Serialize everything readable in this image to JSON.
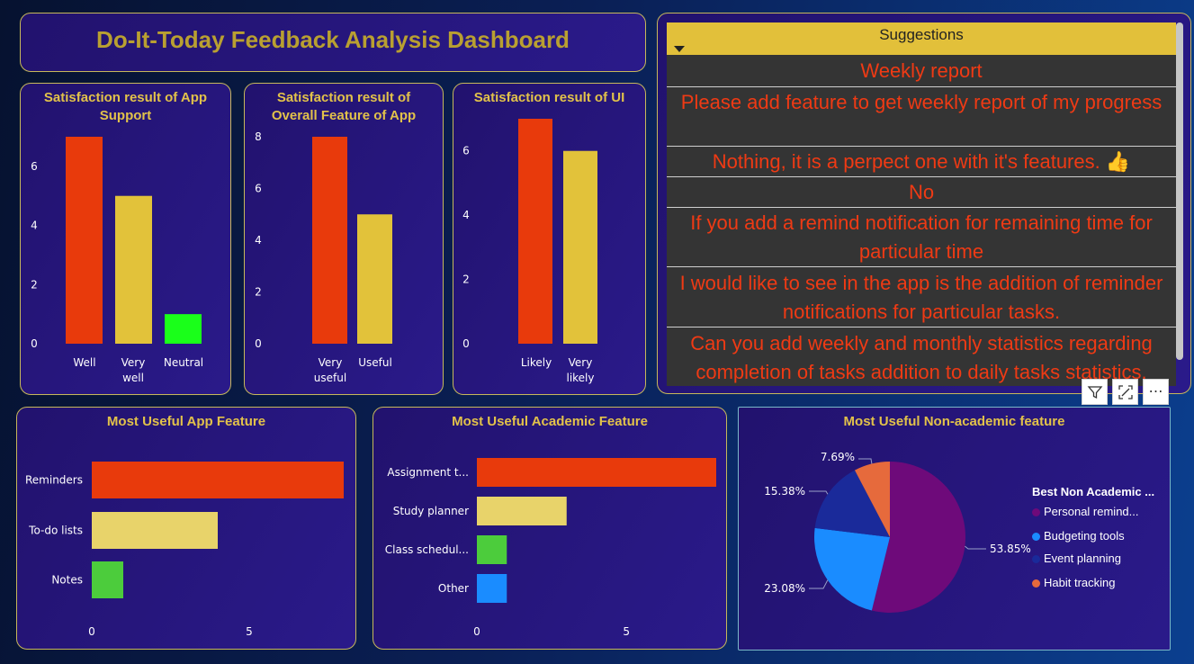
{
  "dashboard_title": "Do-It-Today Feedback Analysis Dashboard",
  "colors": {
    "orange_red": "#e83a0c",
    "gold": "#e2c23a",
    "light_gold": "#e8d36a",
    "green": "#4ccc3c",
    "neon_green": "#1aff1a",
    "blue": "#1a8cff",
    "purple": "#6e0a7a",
    "navy": "#1a2a9a",
    "coral": "#e66a3c",
    "title_gold": "#e2c24a",
    "suggestion_text": "#ef3a14"
  },
  "suggestions": {
    "header": "Suggestions",
    "rows": [
      "Weekly report",
      "Please add feature to get weekly report of my progress",
      "Nothing, it is a perpect one with it's features. 👍",
      "No",
      "If you add a remind notification for remaining time for particular time",
      "I would like to see in the app is the addition of reminder notifications for particular tasks.",
      "Can you add weekly and monthly statistics regarding completion of tasks addition to daily tasks statistics."
    ]
  },
  "toolbar": {
    "filter_icon": "filter-icon",
    "focus_icon": "focus-mode-icon",
    "more_icon": "more-options-icon",
    "more_label": "⋯"
  },
  "chart_data": [
    {
      "id": "app_support",
      "type": "bar",
      "title": "Satisfaction result of App Support",
      "categories": [
        "Well",
        "Very well",
        "Neutral"
      ],
      "values": [
        7,
        5,
        1
      ],
      "ylim": [
        0,
        7
      ],
      "yticks": [
        0,
        2,
        4,
        6
      ],
      "colors": [
        "#e83a0c",
        "#e2c23a",
        "#1aff1a"
      ]
    },
    {
      "id": "overall_feature",
      "type": "bar",
      "title": "Satisfaction result of Overall Feature of App",
      "categories": [
        "Very useful",
        "Useful"
      ],
      "values": [
        8,
        5
      ],
      "ylim": [
        0,
        8
      ],
      "yticks": [
        0,
        2,
        4,
        6,
        8
      ],
      "colors": [
        "#e83a0c",
        "#e2c23a"
      ]
    },
    {
      "id": "ui",
      "type": "bar",
      "title": "Satisfaction result of UI",
      "categories": [
        "Likely",
        "Very likely"
      ],
      "values": [
        7,
        6
      ],
      "ylim": [
        0,
        7
      ],
      "yticks": [
        0,
        2,
        4,
        6
      ],
      "colors": [
        "#e83a0c",
        "#e2c23a"
      ]
    },
    {
      "id": "app_feature",
      "type": "bar",
      "orientation": "horizontal",
      "title": "Most Useful App Feature",
      "categories": [
        "Reminders",
        "To-do lists",
        "Notes"
      ],
      "values": [
        8,
        4,
        1
      ],
      "xlim": [
        0,
        8
      ],
      "xticks": [
        0,
        5
      ],
      "colors": [
        "#e83a0c",
        "#e8d36a",
        "#4ccc3c"
      ]
    },
    {
      "id": "academic_feature",
      "type": "bar",
      "orientation": "horizontal",
      "title": "Most Useful Academic Feature",
      "categories": [
        "Assignment t...",
        "Study planner",
        "Class schedul...",
        "Other"
      ],
      "values": [
        8,
        3,
        1,
        1
      ],
      "xlim": [
        0,
        8
      ],
      "xticks": [
        0,
        5
      ],
      "colors": [
        "#e83a0c",
        "#e8d36a",
        "#4ccc3c",
        "#1a8cff"
      ]
    },
    {
      "id": "non_academic",
      "type": "pie",
      "title": "Most Useful Non-academic feature",
      "legend_title": "Best Non Academic ...",
      "legend_position": "right",
      "slices": [
        {
          "label": "Personal remind...",
          "value": 53.85,
          "display": "53.85%",
          "color": "#6e0a7a"
        },
        {
          "label": "Budgeting tools",
          "value": 23.08,
          "display": "23.08%",
          "color": "#1a8cff"
        },
        {
          "label": "Event planning",
          "value": 15.38,
          "display": "15.38%",
          "color": "#1a2a9a"
        },
        {
          "label": "Habit tracking",
          "value": 7.69,
          "display": "7.69%",
          "color": "#e66a3c"
        }
      ]
    }
  ]
}
